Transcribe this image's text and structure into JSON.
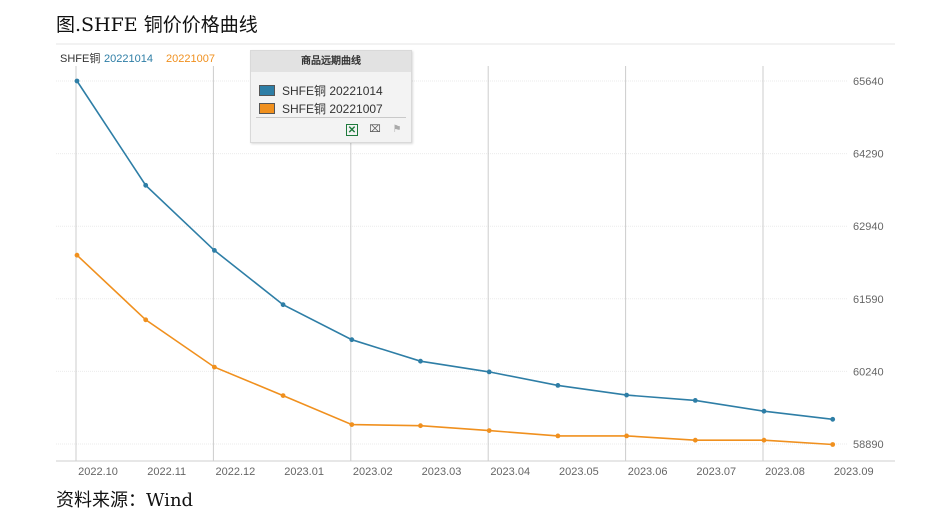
{
  "page": {
    "title": "图.SHFE 铜价价格曲线",
    "source": "资料来源：Wind"
  },
  "legend_header": {
    "prefix": "SHFE铜",
    "series_1": "20221014",
    "series_2": "20221007"
  },
  "legend_popup": {
    "title": "商品远期曲线",
    "items": [
      {
        "label": "SHFE铜 20221014",
        "color": "#2e7ea6"
      },
      {
        "label": "SHFE铜 20221007",
        "color": "#f0901e"
      }
    ],
    "tools": [
      "excel-icon",
      "crop-icon",
      "flag-icon"
    ]
  },
  "chart_data": {
    "type": "line",
    "categories": [
      "2022.10",
      "2022.11",
      "2022.12",
      "2023.01",
      "2023.02",
      "2023.03",
      "2023.04",
      "2023.05",
      "2023.06",
      "2023.07",
      "2023.08",
      "2023.09"
    ],
    "y_ticks": [
      58890,
      60240,
      61590,
      62940,
      64290,
      65640
    ],
    "ylim": [
      58700,
      65900
    ],
    "y_axis_position": "right",
    "grid": true,
    "legend_placement": "top-left",
    "series": [
      {
        "name": "SHFE铜 20221014",
        "color": "#2e7ea6",
        "values": [
          65640,
          63700,
          62490,
          61480,
          60830,
          60430,
          60230,
          59980,
          59800,
          59700,
          59500,
          59350
        ]
      },
      {
        "name": "SHFE铜 20221007",
        "color": "#f0901e",
        "values": [
          62400,
          61200,
          60320,
          59790,
          59250,
          59230,
          59140,
          59040,
          59040,
          58960,
          58960,
          58880
        ]
      }
    ]
  }
}
